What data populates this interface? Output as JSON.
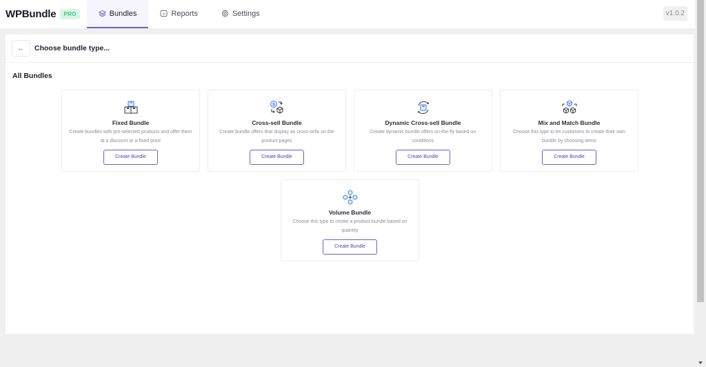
{
  "header": {
    "brand": "WPBundle",
    "badge": "PRO",
    "version": "v1.0.2",
    "tabs": [
      {
        "label": "Bundles",
        "icon": "layers-icon",
        "active": true
      },
      {
        "label": "Reports",
        "icon": "chart-icon",
        "active": false
      },
      {
        "label": "Settings",
        "icon": "gear-icon",
        "active": false
      }
    ]
  },
  "panel": {
    "back_icon": "arrow-left-icon",
    "title": "Choose bundle type...",
    "section_title": "All Bundles"
  },
  "bundles": [
    {
      "title": "Fixed Bundle",
      "desc": "Create bundles with pre-selected products and offer them at a discount or a fixed price",
      "button": "Create Bundle",
      "icon": "boxes-stack-icon"
    },
    {
      "title": "Cross-sell Bundle",
      "desc": "Create bundle offers that display as cross-sells on the product pages",
      "button": "Create Bundle",
      "icon": "dollar-exchange-icon"
    },
    {
      "title": "Dynamic Cross-sell Bundle",
      "desc": "Create dynamic bundle offers on-the-fly based on conditions",
      "button": "Create Bundle",
      "icon": "refresh-box-icon"
    },
    {
      "title": "Mix and Match Bundle",
      "desc": "Choose this type to let customers to create their own bundle by choosing items",
      "button": "Create Bundle",
      "icon": "cubes-icon"
    },
    {
      "title": "Volume Bundle",
      "desc": "Choose this type to create a product bundle based on quantity",
      "button": "Create Bundle",
      "icon": "cubes-plus-icon"
    }
  ],
  "colors": {
    "accent": "#6a5fc4",
    "icon_blue": "#3b82f6",
    "pro_bg": "#d9f7e4",
    "pro_text": "#3bc57a"
  }
}
